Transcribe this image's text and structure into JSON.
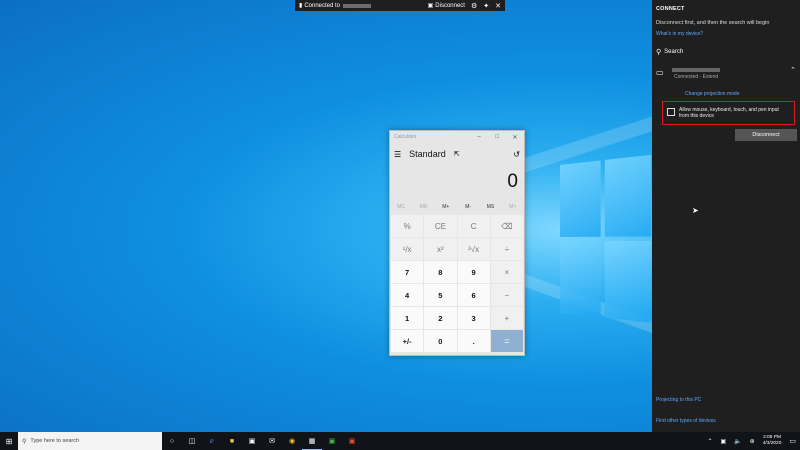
{
  "topbar": {
    "connected_label": "Connected to",
    "disconnect_label": "Disconnect",
    "icons": [
      "cast-icon",
      "gear-icon",
      "pin-icon",
      "close-icon"
    ]
  },
  "calculator": {
    "window_title": "Calculator",
    "mode": "Standard",
    "display": "0",
    "memory": [
      "MC",
      "MR",
      "M+",
      "M-",
      "MS",
      "M˅"
    ],
    "keys": [
      "%",
      "CE",
      "C",
      "⌫",
      "¹/x",
      "x²",
      "²√x",
      "÷",
      "7",
      "8",
      "9",
      "×",
      "4",
      "5",
      "6",
      "−",
      "1",
      "2",
      "3",
      "+",
      "+/-",
      "0",
      ".",
      "="
    ]
  },
  "panel": {
    "header": "CONNECT",
    "message": "Disconnect first, and then the search will begin",
    "what_link": "What's in my device?",
    "search_label": "Search",
    "device_status": "Connected - Extend",
    "change_mode_link": "Change projection mode",
    "allow_input_label": "Allow mouse, keyboard, touch, and pen input from this device",
    "disconnect_button": "Disconnect",
    "projecting_link": "Projecting to this PC",
    "find_link": "Find other types of devices"
  },
  "taskbar": {
    "search_placeholder": "Type here to search",
    "time": "2:05 PM",
    "date": "4/3/2020"
  },
  "colors": {
    "panel_bg": "#1f1f1f",
    "link": "#5fa8ff",
    "highlight": "#d8181e",
    "equals_key": "#8fb0d0"
  }
}
